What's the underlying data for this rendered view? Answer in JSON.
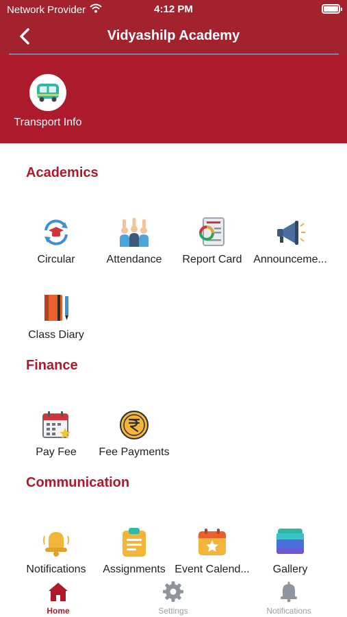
{
  "status_bar": {
    "carrier": "Network Provider",
    "time": "4:12 PM"
  },
  "nav": {
    "title": "Vidyashilp Academy"
  },
  "quick": {
    "transport_label": "Transport Info"
  },
  "sections": {
    "academics": {
      "title": "Academics",
      "items": [
        {
          "label": "Circular",
          "icon": "circular-icon"
        },
        {
          "label": "Attendance",
          "icon": "attendance-icon"
        },
        {
          "label": "Report Card",
          "icon": "report-card-icon"
        },
        {
          "label": "Announceme...",
          "icon": "megaphone-icon"
        },
        {
          "label": "Class Diary",
          "icon": "diary-icon"
        }
      ]
    },
    "finance": {
      "title": "Finance",
      "items": [
        {
          "label": "Pay Fee",
          "icon": "calendar-icon"
        },
        {
          "label": "Fee Payments",
          "icon": "rupee-coin-icon"
        }
      ]
    },
    "communication": {
      "title": "Communication",
      "items": [
        {
          "label": "Notifications",
          "icon": "bell-icon"
        },
        {
          "label": "Assignments",
          "icon": "clipboard-icon"
        },
        {
          "label": "Event Calend...",
          "icon": "event-calendar-icon"
        },
        {
          "label": "Gallery",
          "icon": "gallery-icon"
        }
      ]
    }
  },
  "tabs": [
    {
      "label": "Home",
      "icon": "home-icon",
      "active": true
    },
    {
      "label": "Settings",
      "icon": "gear-icon",
      "active": false
    },
    {
      "label": "Notifications",
      "icon": "bell-icon",
      "active": false
    }
  ],
  "colors": {
    "brand": "#ad1a2b",
    "header": "#a2222e",
    "tab_inactive": "#9aa0a8"
  }
}
